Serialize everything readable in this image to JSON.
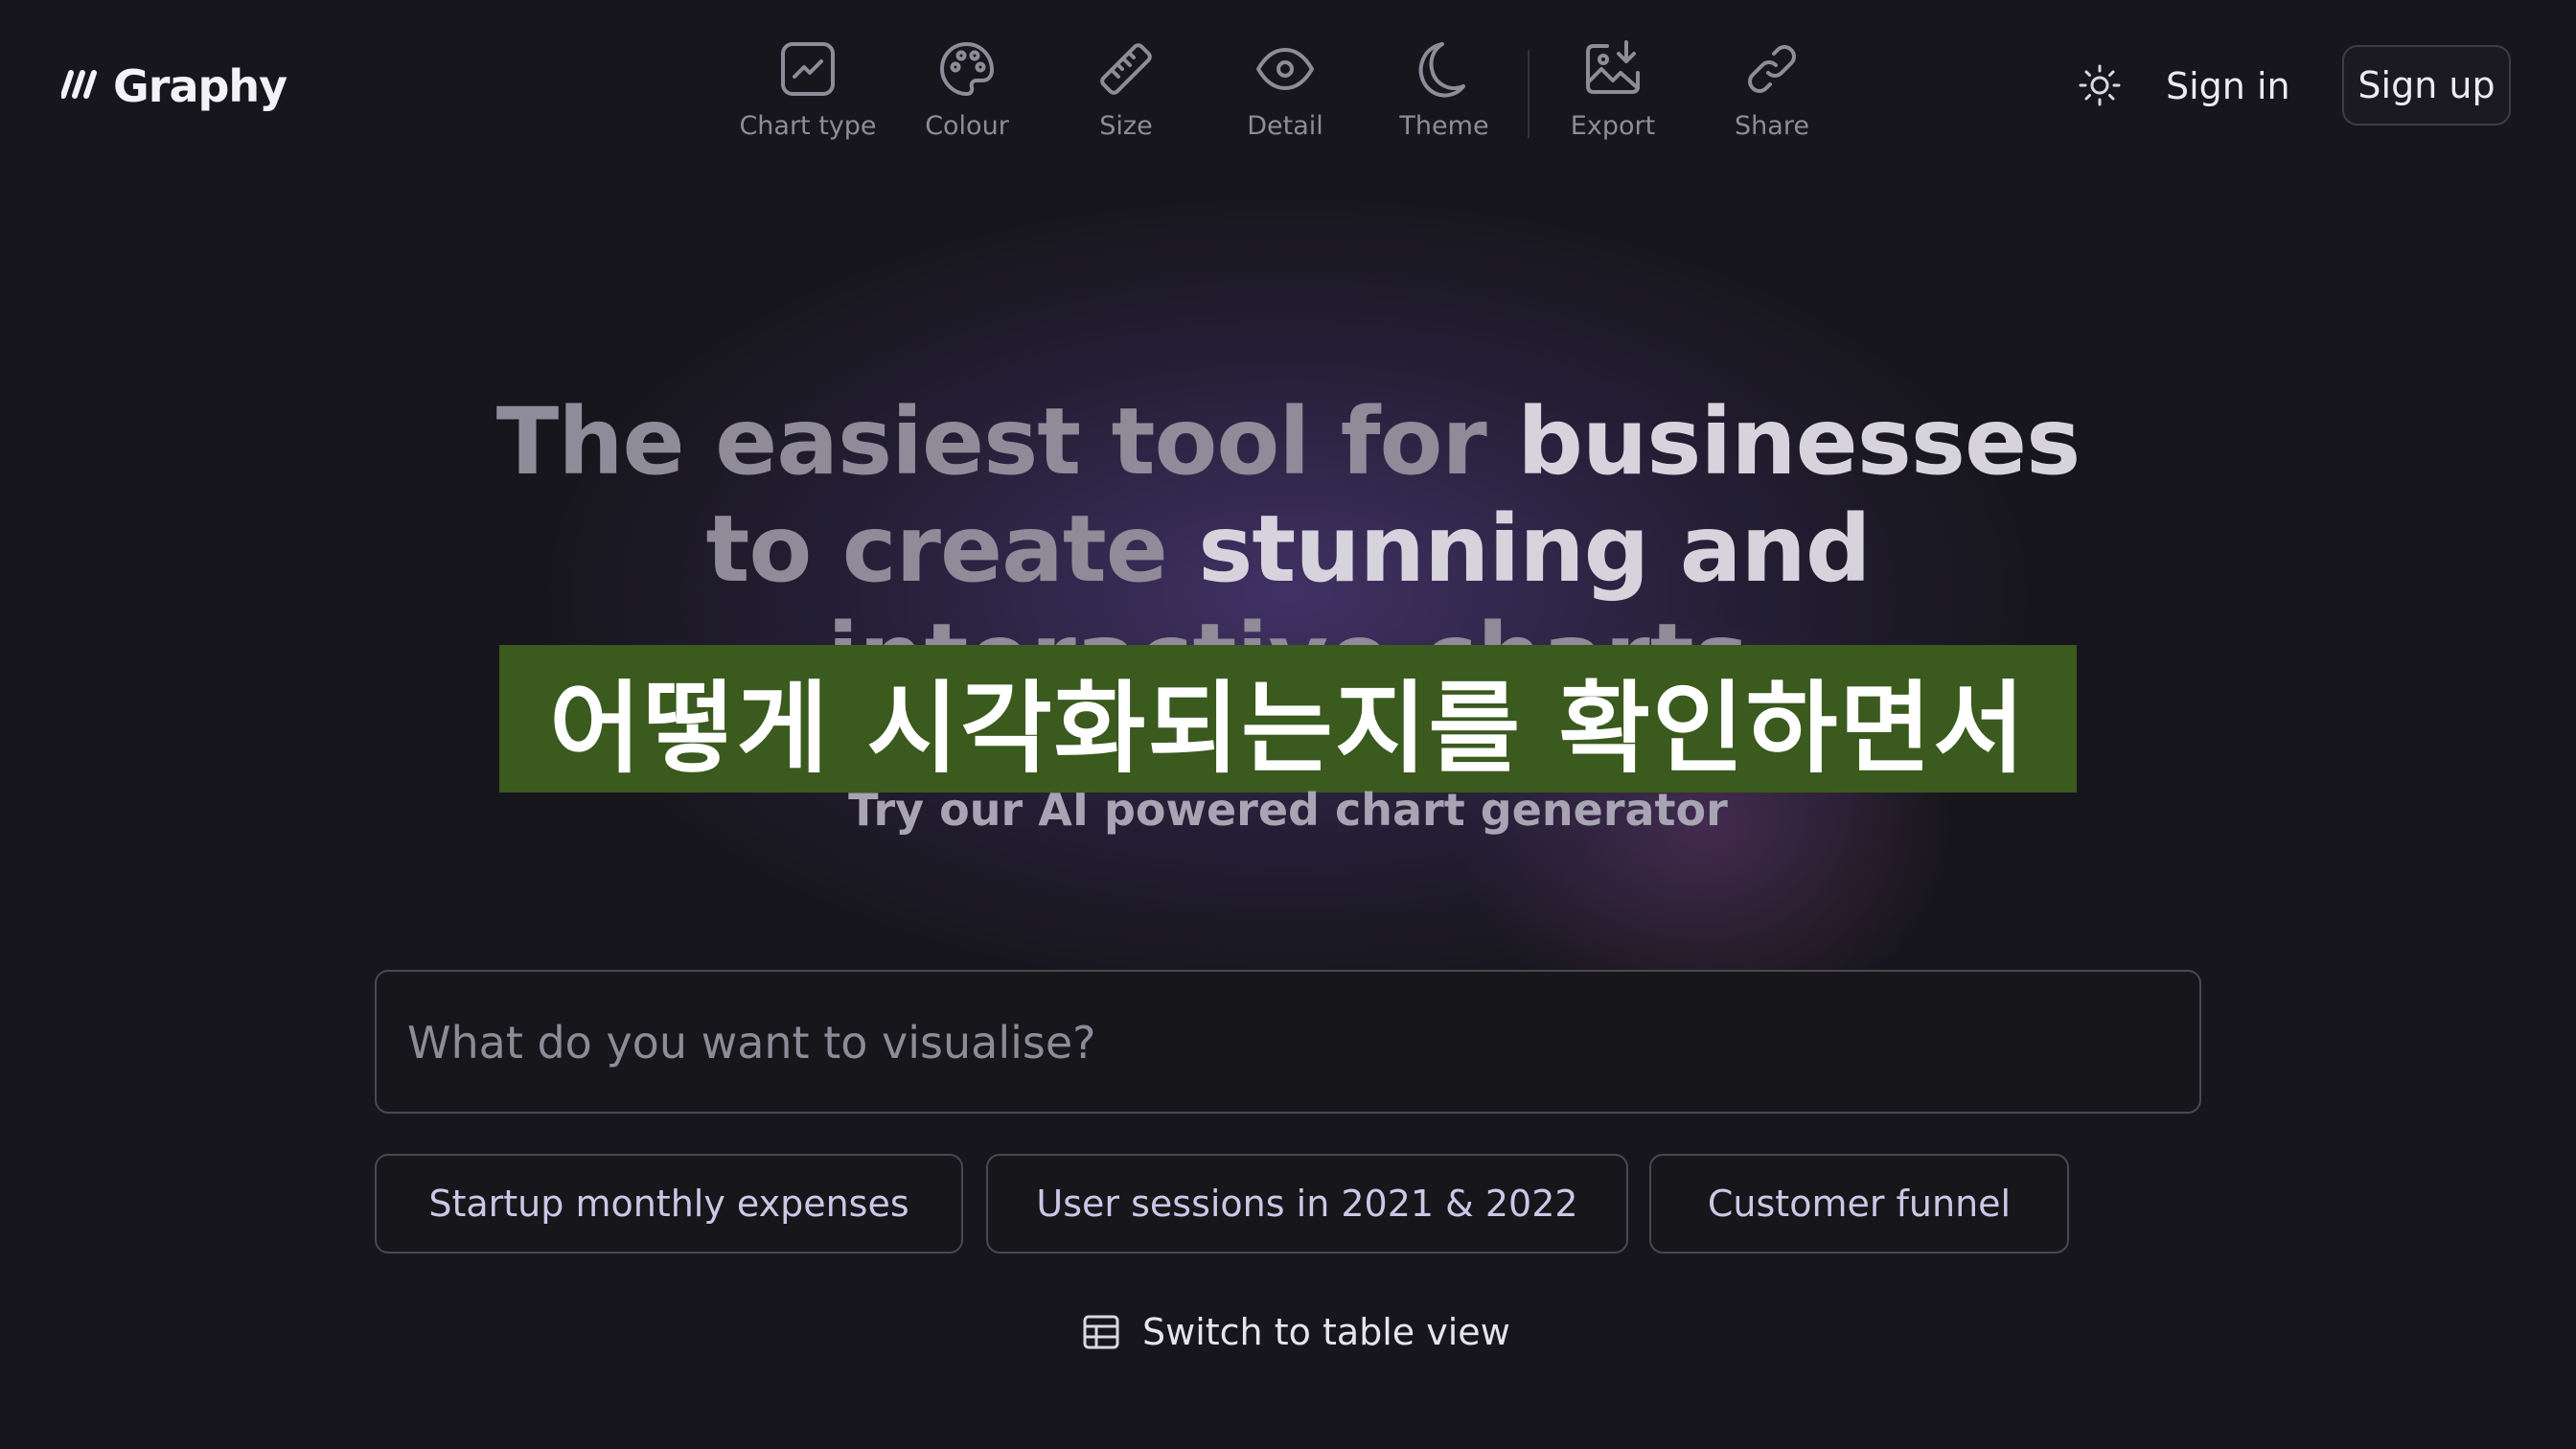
{
  "brand": {
    "name": "Graphy"
  },
  "toolbar": {
    "items": [
      {
        "label": "Chart type",
        "icon": "chart-line-icon"
      },
      {
        "label": "Colour",
        "icon": "palette-icon"
      },
      {
        "label": "Size",
        "icon": "ruler-icon"
      },
      {
        "label": "Detail",
        "icon": "eye-icon"
      },
      {
        "label": "Theme",
        "icon": "moon-icon"
      },
      {
        "label": "Export",
        "icon": "image-download-icon"
      },
      {
        "label": "Share",
        "icon": "link-icon"
      }
    ]
  },
  "auth": {
    "theme_icon": "sun-icon",
    "sign_in": "Sign in",
    "sign_up": "Sign up"
  },
  "hero": {
    "line1_dim": "The easiest tool for ",
    "line1_bright": "businesses",
    "line2_dim": "to create ",
    "line2_bright": "stunning and",
    "line3_partial": "interactive charts"
  },
  "caption": {
    "text": "어떻게 시각화되는지를 확인하면서"
  },
  "subtitle": "Try our AI powered chart generator",
  "prompt": {
    "placeholder": "What do you want to visualise?",
    "value": ""
  },
  "suggestions": [
    "Startup monthly expenses",
    "User sessions in 2021 & 2022",
    "Customer funnel"
  ],
  "table_switch": {
    "label": "Switch to table view",
    "icon": "table-icon"
  },
  "colors": {
    "background": "#17161c",
    "glow": "#6248a0",
    "caption_band": "#3a5a1e",
    "chip_text": "#cdc7e6"
  }
}
